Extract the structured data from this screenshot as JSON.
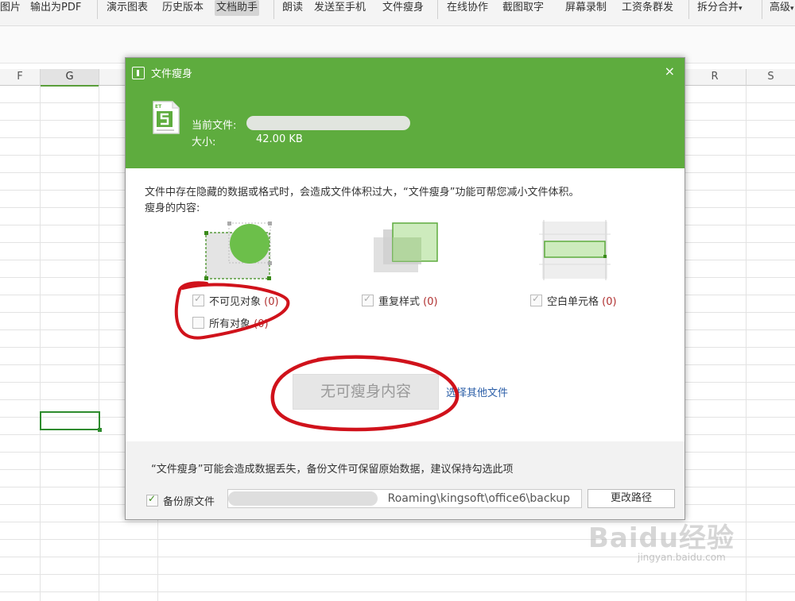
{
  "toolbar": {
    "items": [
      "图片",
      "输出为PDF",
      "演示图表",
      "历史版本",
      "文档助手",
      "朗读",
      "发送至手机",
      "文件瘦身",
      "在线协作",
      "截图取字",
      "屏幕录制",
      "工资条群发",
      "拆分合并",
      "高级"
    ],
    "dropdown_marks": [
      "▾",
      "▾"
    ]
  },
  "sheet": {
    "columns": [
      "F",
      "G",
      "R",
      "S"
    ]
  },
  "dialog": {
    "title": "文件瘦身",
    "close": "×",
    "file_icon_text": "ET",
    "current_file_label": "当前文件:",
    "size_label": "大小:",
    "size_value": "42.00 KB",
    "description": "文件中存在隐藏的数据或格式时，会造成文件体积过大，“文件瘦身”功能可帮您减小文件体积。",
    "content_label": "瘦身的内容:",
    "options": {
      "invisible_objects": {
        "label": "不可见对象",
        "count": "(0)",
        "checked": true
      },
      "all_objects": {
        "label": "所有对象",
        "count": "(0)",
        "checked": false
      },
      "duplicate_styles": {
        "label": "重复样式",
        "count": "(0)",
        "checked": true
      },
      "blank_cells": {
        "label": "空白单元格",
        "count": "(0)",
        "checked": true
      }
    },
    "main_button": "无可瘦身内容",
    "choose_other_link": "选择其他文件",
    "warning": "“文件瘦身”可能会造成数据丢失，备份文件可保留原始数据，建议保持勾选此项",
    "backup_label": "备份原文件",
    "backup_path_visible": "Roaming\\kingsoft\\office6\\backup",
    "change_path_button": "更改路径"
  },
  "watermark": {
    "main": "Baidu经验",
    "sub": "jingyan.baidu.com"
  },
  "colors": {
    "header_green": "#5eac3e",
    "annotation_red": "#d0121b"
  }
}
